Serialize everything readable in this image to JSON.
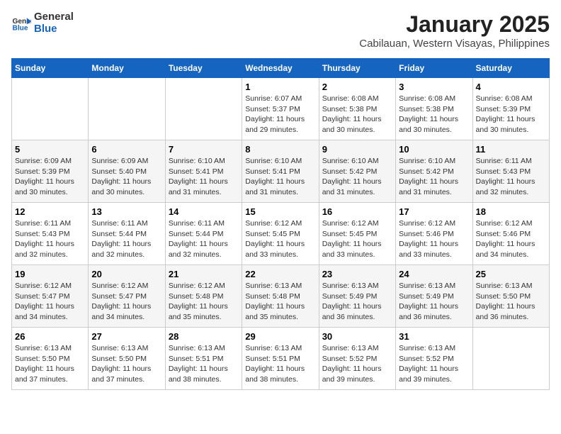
{
  "logo": {
    "line1": "General",
    "line2": "Blue",
    "icon_color": "#1565c0"
  },
  "title": "January 2025",
  "location": "Cabilauan, Western Visayas, Philippines",
  "weekdays": [
    "Sunday",
    "Monday",
    "Tuesday",
    "Wednesday",
    "Thursday",
    "Friday",
    "Saturday"
  ],
  "weeks": [
    [
      {
        "day": "",
        "info": ""
      },
      {
        "day": "",
        "info": ""
      },
      {
        "day": "",
        "info": ""
      },
      {
        "day": "1",
        "info": "Sunrise: 6:07 AM\nSunset: 5:37 PM\nDaylight: 11 hours\nand 29 minutes."
      },
      {
        "day": "2",
        "info": "Sunrise: 6:08 AM\nSunset: 5:38 PM\nDaylight: 11 hours\nand 30 minutes."
      },
      {
        "day": "3",
        "info": "Sunrise: 6:08 AM\nSunset: 5:38 PM\nDaylight: 11 hours\nand 30 minutes."
      },
      {
        "day": "4",
        "info": "Sunrise: 6:08 AM\nSunset: 5:39 PM\nDaylight: 11 hours\nand 30 minutes."
      }
    ],
    [
      {
        "day": "5",
        "info": "Sunrise: 6:09 AM\nSunset: 5:39 PM\nDaylight: 11 hours\nand 30 minutes."
      },
      {
        "day": "6",
        "info": "Sunrise: 6:09 AM\nSunset: 5:40 PM\nDaylight: 11 hours\nand 30 minutes."
      },
      {
        "day": "7",
        "info": "Sunrise: 6:10 AM\nSunset: 5:41 PM\nDaylight: 11 hours\nand 31 minutes."
      },
      {
        "day": "8",
        "info": "Sunrise: 6:10 AM\nSunset: 5:41 PM\nDaylight: 11 hours\nand 31 minutes."
      },
      {
        "day": "9",
        "info": "Sunrise: 6:10 AM\nSunset: 5:42 PM\nDaylight: 11 hours\nand 31 minutes."
      },
      {
        "day": "10",
        "info": "Sunrise: 6:10 AM\nSunset: 5:42 PM\nDaylight: 11 hours\nand 31 minutes."
      },
      {
        "day": "11",
        "info": "Sunrise: 6:11 AM\nSunset: 5:43 PM\nDaylight: 11 hours\nand 32 minutes."
      }
    ],
    [
      {
        "day": "12",
        "info": "Sunrise: 6:11 AM\nSunset: 5:43 PM\nDaylight: 11 hours\nand 32 minutes."
      },
      {
        "day": "13",
        "info": "Sunrise: 6:11 AM\nSunset: 5:44 PM\nDaylight: 11 hours\nand 32 minutes."
      },
      {
        "day": "14",
        "info": "Sunrise: 6:11 AM\nSunset: 5:44 PM\nDaylight: 11 hours\nand 32 minutes."
      },
      {
        "day": "15",
        "info": "Sunrise: 6:12 AM\nSunset: 5:45 PM\nDaylight: 11 hours\nand 33 minutes."
      },
      {
        "day": "16",
        "info": "Sunrise: 6:12 AM\nSunset: 5:45 PM\nDaylight: 11 hours\nand 33 minutes."
      },
      {
        "day": "17",
        "info": "Sunrise: 6:12 AM\nSunset: 5:46 PM\nDaylight: 11 hours\nand 33 minutes."
      },
      {
        "day": "18",
        "info": "Sunrise: 6:12 AM\nSunset: 5:46 PM\nDaylight: 11 hours\nand 34 minutes."
      }
    ],
    [
      {
        "day": "19",
        "info": "Sunrise: 6:12 AM\nSunset: 5:47 PM\nDaylight: 11 hours\nand 34 minutes."
      },
      {
        "day": "20",
        "info": "Sunrise: 6:12 AM\nSunset: 5:47 PM\nDaylight: 11 hours\nand 34 minutes."
      },
      {
        "day": "21",
        "info": "Sunrise: 6:12 AM\nSunset: 5:48 PM\nDaylight: 11 hours\nand 35 minutes."
      },
      {
        "day": "22",
        "info": "Sunrise: 6:13 AM\nSunset: 5:48 PM\nDaylight: 11 hours\nand 35 minutes."
      },
      {
        "day": "23",
        "info": "Sunrise: 6:13 AM\nSunset: 5:49 PM\nDaylight: 11 hours\nand 36 minutes."
      },
      {
        "day": "24",
        "info": "Sunrise: 6:13 AM\nSunset: 5:49 PM\nDaylight: 11 hours\nand 36 minutes."
      },
      {
        "day": "25",
        "info": "Sunrise: 6:13 AM\nSunset: 5:50 PM\nDaylight: 11 hours\nand 36 minutes."
      }
    ],
    [
      {
        "day": "26",
        "info": "Sunrise: 6:13 AM\nSunset: 5:50 PM\nDaylight: 11 hours\nand 37 minutes."
      },
      {
        "day": "27",
        "info": "Sunrise: 6:13 AM\nSunset: 5:50 PM\nDaylight: 11 hours\nand 37 minutes."
      },
      {
        "day": "28",
        "info": "Sunrise: 6:13 AM\nSunset: 5:51 PM\nDaylight: 11 hours\nand 38 minutes."
      },
      {
        "day": "29",
        "info": "Sunrise: 6:13 AM\nSunset: 5:51 PM\nDaylight: 11 hours\nand 38 minutes."
      },
      {
        "day": "30",
        "info": "Sunrise: 6:13 AM\nSunset: 5:52 PM\nDaylight: 11 hours\nand 39 minutes."
      },
      {
        "day": "31",
        "info": "Sunrise: 6:13 AM\nSunset: 5:52 PM\nDaylight: 11 hours\nand 39 minutes."
      },
      {
        "day": "",
        "info": ""
      }
    ]
  ]
}
